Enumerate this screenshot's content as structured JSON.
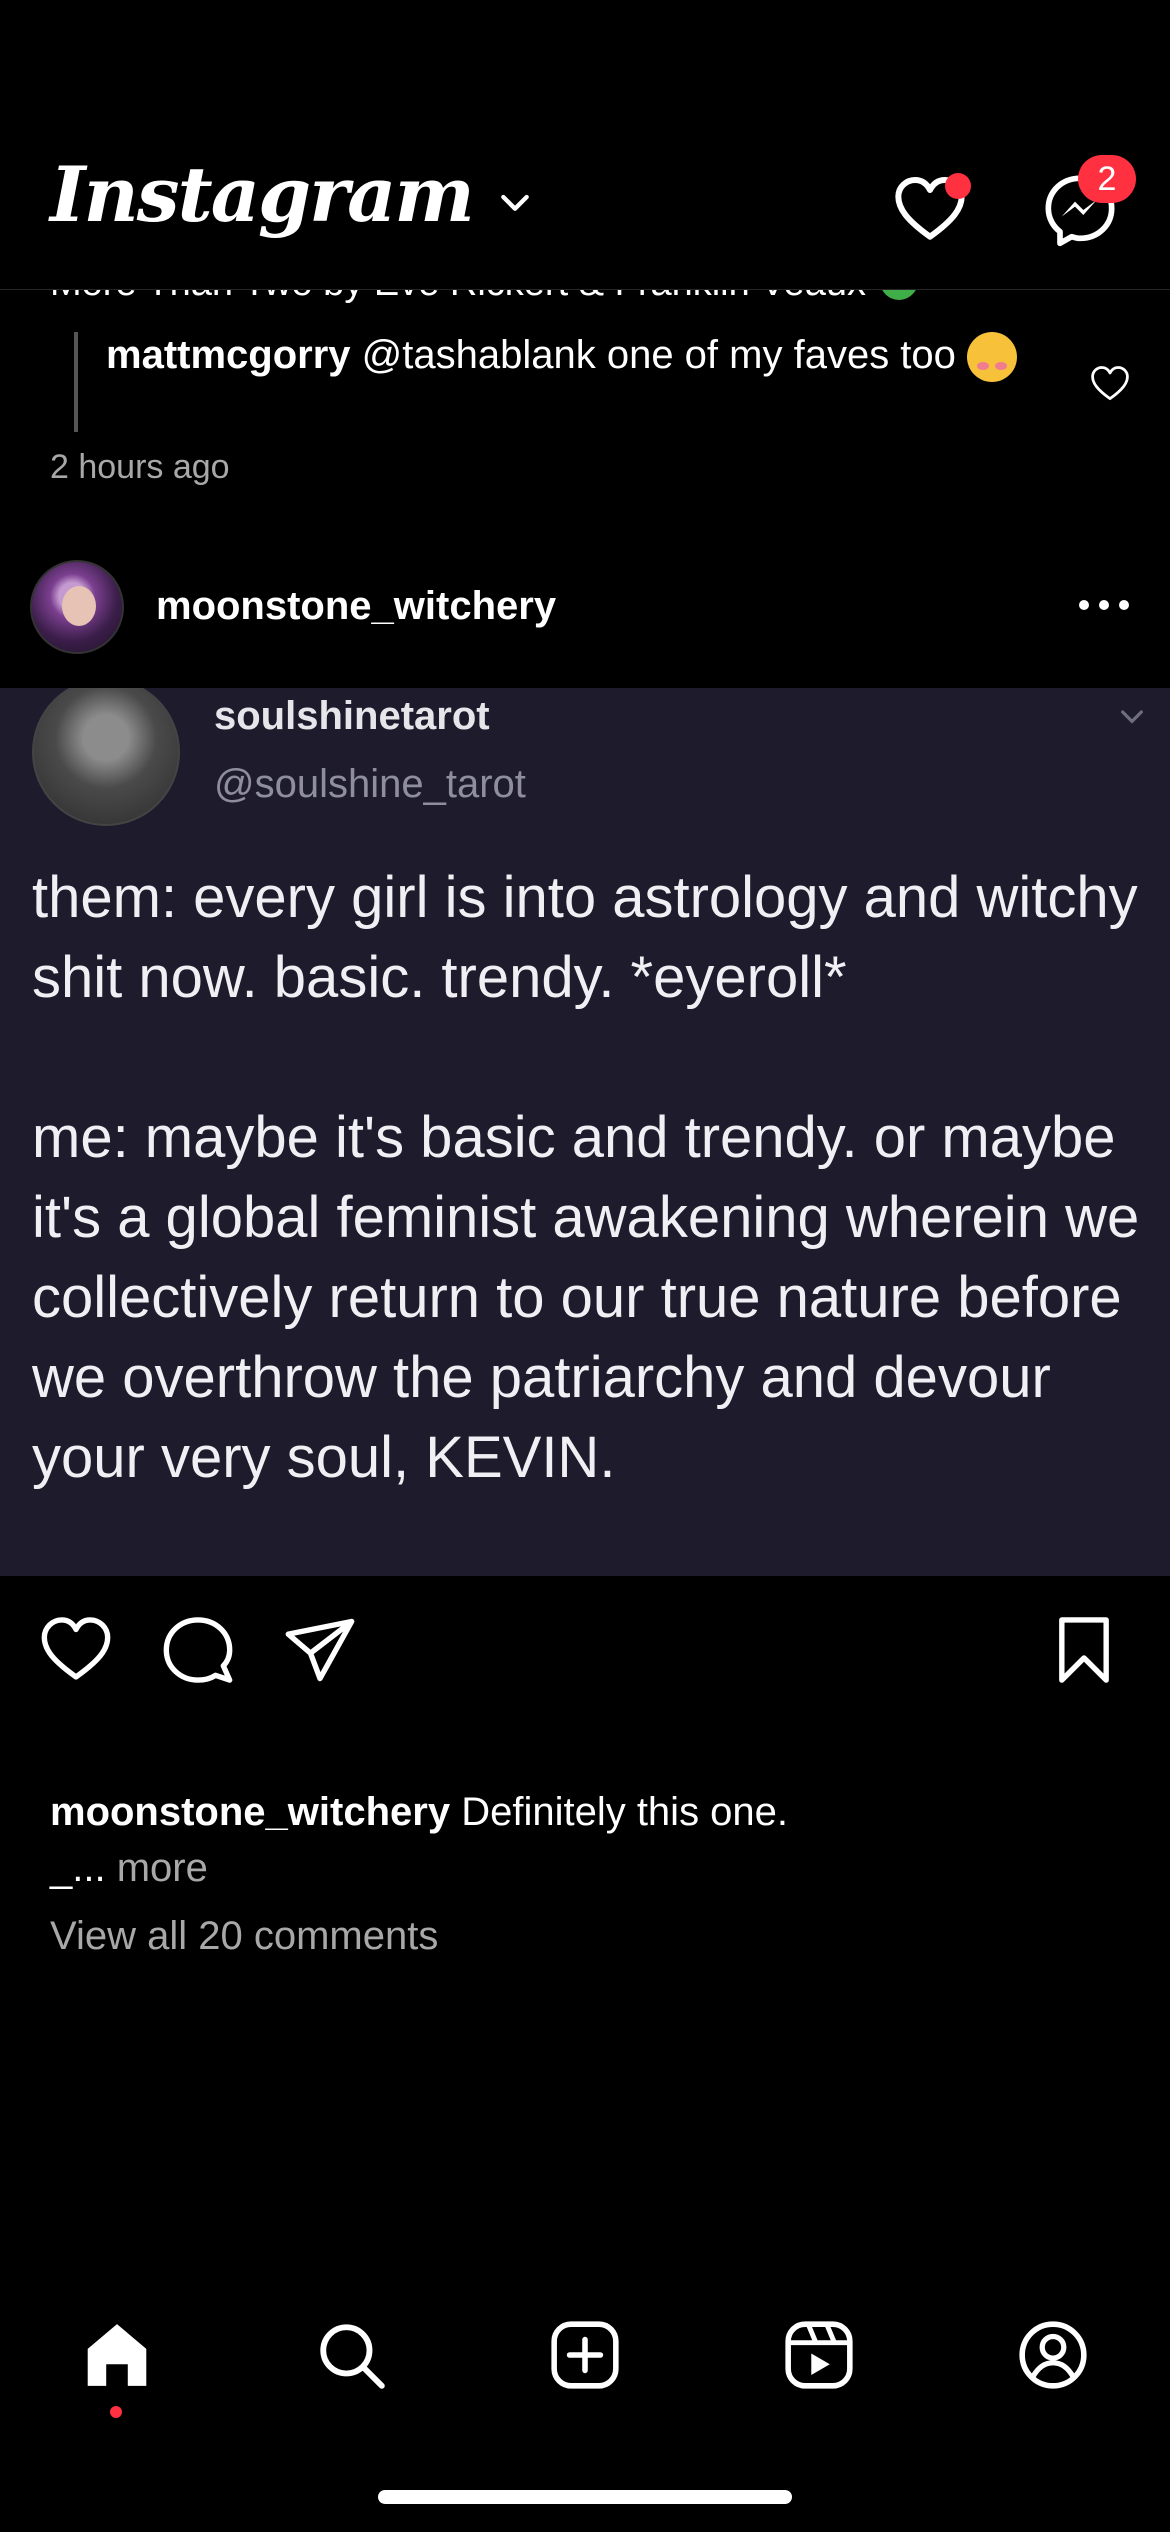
{
  "app": {
    "title": "Instagram",
    "notification_badge": "2",
    "accent_color": "#ff3040"
  },
  "previous_post": {
    "clipped_caption": "More Than Two by Eve Rickert & Franklin Veaux",
    "reply": {
      "user": "mattmcgorry",
      "text": " @tashablank one of my faves too "
    },
    "timestamp": "2 hours ago"
  },
  "post": {
    "username": "moonstone_witchery",
    "image": {
      "tweet_name": "soulshinetarot",
      "tweet_handle": "@soulshine_tarot",
      "tweet_para1": "them: every girl is into astrology and witchy shit now. basic. trendy. *eyeroll*",
      "tweet_para2": "me: maybe it's basic and trendy. or maybe it's a global feminist awakening wherein we collectively return to our true nature before we overthrow the patriarchy and devour your very soul, KEVIN."
    },
    "caption_user": "moonstone_witchery",
    "caption_text": " Definitely this one.",
    "caption_cont": "_...",
    "caption_more": " more",
    "view_comments": "View all 20 comments"
  },
  "icons": {
    "top": [
      "chevron-down-icon",
      "heart-icon",
      "messenger-icon"
    ],
    "actions": [
      "heart-icon",
      "comment-icon",
      "share-icon",
      "bookmark-icon"
    ],
    "tabs": [
      "home-icon",
      "search-icon",
      "create-icon",
      "reels-icon",
      "profile-icon"
    ]
  }
}
